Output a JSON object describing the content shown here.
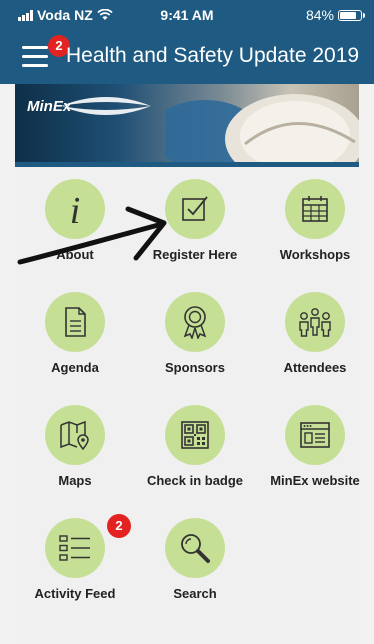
{
  "status_bar": {
    "carrier": "Voda NZ",
    "time": "9:41 AM",
    "battery": "84%",
    "battery_level": 0.84
  },
  "header": {
    "title": "Health and Safety Update 2019",
    "menu_badge": "2"
  },
  "banner": {
    "logo_text": "MinEx"
  },
  "tiles": [
    {
      "label": "About",
      "icon": "info-icon"
    },
    {
      "label": "Register Here",
      "icon": "checkbox-icon"
    },
    {
      "label": "Workshops",
      "icon": "calendar-icon"
    },
    {
      "label": "Agenda",
      "icon": "document-icon"
    },
    {
      "label": "Sponsors",
      "icon": "award-ribbon-icon"
    },
    {
      "label": "Attendees",
      "icon": "people-icon"
    },
    {
      "label": "Maps",
      "icon": "map-pin-icon"
    },
    {
      "label": "Check in badge",
      "icon": "qr-code-icon"
    },
    {
      "label": "MinEx website",
      "icon": "browser-window-icon"
    },
    {
      "label": "Activity Feed",
      "icon": "list-icon",
      "badge": "2"
    },
    {
      "label": "Search",
      "icon": "magnifier-icon"
    }
  ]
}
